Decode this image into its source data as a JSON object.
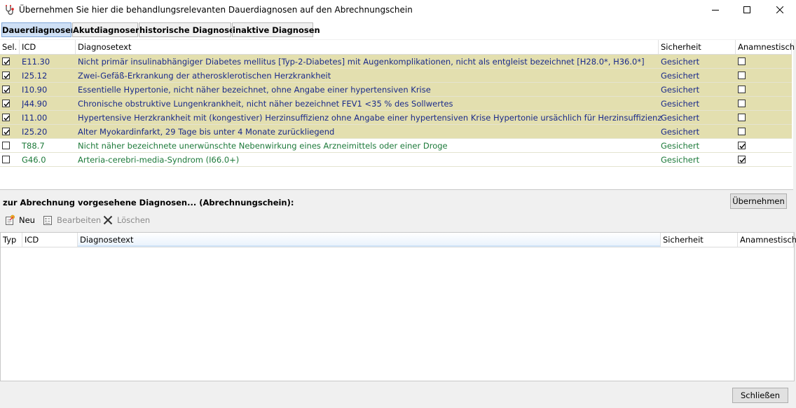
{
  "window": {
    "title": "Übernehmen Sie hier die behandlungsrelevanten Dauerdiagnosen auf den Abrechnungschein",
    "icons": {
      "app": "stethoscope-icon",
      "minimize": "minimize-icon",
      "maximize": "maximize-icon",
      "close": "close-icon"
    }
  },
  "tabs": [
    {
      "label": "Dauerdiagnosen",
      "active": true
    },
    {
      "label": "Akutdiagnosen",
      "active": false
    },
    {
      "label": "historische Diagnosen",
      "active": false
    },
    {
      "label": "inaktive Diagnosen",
      "active": false
    }
  ],
  "top_grid": {
    "columns": [
      "Sel.",
      "ICD",
      "Diagnosetext",
      "Sicherheit",
      "Anamnestisch"
    ],
    "rows": [
      {
        "selected": true,
        "icd": "E11.30",
        "text": "Nicht primär insulinabhängiger Diabetes mellitus [Typ-2-Diabetes] mit Augenkomplikationen, nicht als entgleist bezeichnet [H28.0*, H36.0*]",
        "sicherheit": "Gesichert",
        "anamnestisch": false
      },
      {
        "selected": true,
        "icd": "I25.12",
        "text": "Zwei-Gefäß-Erkrankung der atherosklerotischen Herzkrankheit",
        "sicherheit": "Gesichert",
        "anamnestisch": false
      },
      {
        "selected": true,
        "icd": "I10.90",
        "text": "Essentielle Hypertonie, nicht näher bezeichnet, ohne Angabe einer hypertensiven Krise",
        "sicherheit": "Gesichert",
        "anamnestisch": false
      },
      {
        "selected": true,
        "icd": "J44.90",
        "text": "Chronische obstruktive Lungenkrankheit, nicht näher bezeichnet FEV1 <35 % des Sollwertes",
        "sicherheit": "Gesichert",
        "anamnestisch": false
      },
      {
        "selected": true,
        "icd": "I11.00",
        "text": "Hypertensive Herzkrankheit mit (kongestiver) Herzinsuffizienz ohne Angabe einer hypertensiven Krise Hypertonie ursächlich für Herzinsuffizienz",
        "sicherheit": "Gesichert",
        "anamnestisch": false
      },
      {
        "selected": true,
        "icd": "I25.20",
        "text": "Alter Myokardinfarkt, 29 Tage bis unter 4 Monate zurückliegend",
        "sicherheit": "Gesichert",
        "anamnestisch": false
      },
      {
        "selected": false,
        "icd": "T88.7",
        "text": "Nicht näher bezeichnete unerwünschte Nebenwirkung eines Arzneimittels oder einer Droge",
        "sicherheit": "Gesichert",
        "anamnestisch": true
      },
      {
        "selected": false,
        "icd": "G46.0",
        "text": "Arteria-cerebri-media-Syndrom  (I66.0+)",
        "sicherheit": "Gesichert",
        "anamnestisch": true
      }
    ],
    "colors": {
      "selected_row_bg": "#e3dfaf",
      "selected_text": "#1a2a8a",
      "unselected_text": "#1d7a3a"
    }
  },
  "section": {
    "label": "zur Abrechnung vorgesehene Diagnosen... (Abrechnungschein):",
    "apply_button": "Übernehmen"
  },
  "toolbar": {
    "new_label": "Neu",
    "edit_label": "Bearbeiten",
    "delete_label": "Löschen",
    "icons": {
      "new": "new-document-icon",
      "edit": "edit-form-icon",
      "delete": "delete-x-icon"
    }
  },
  "bottom_grid": {
    "columns": [
      "Typ",
      "ICD",
      "Diagnosetext",
      "Sicherheit",
      "Anamnestisch"
    ],
    "rows": []
  },
  "footer": {
    "close_button": "Schließen"
  }
}
